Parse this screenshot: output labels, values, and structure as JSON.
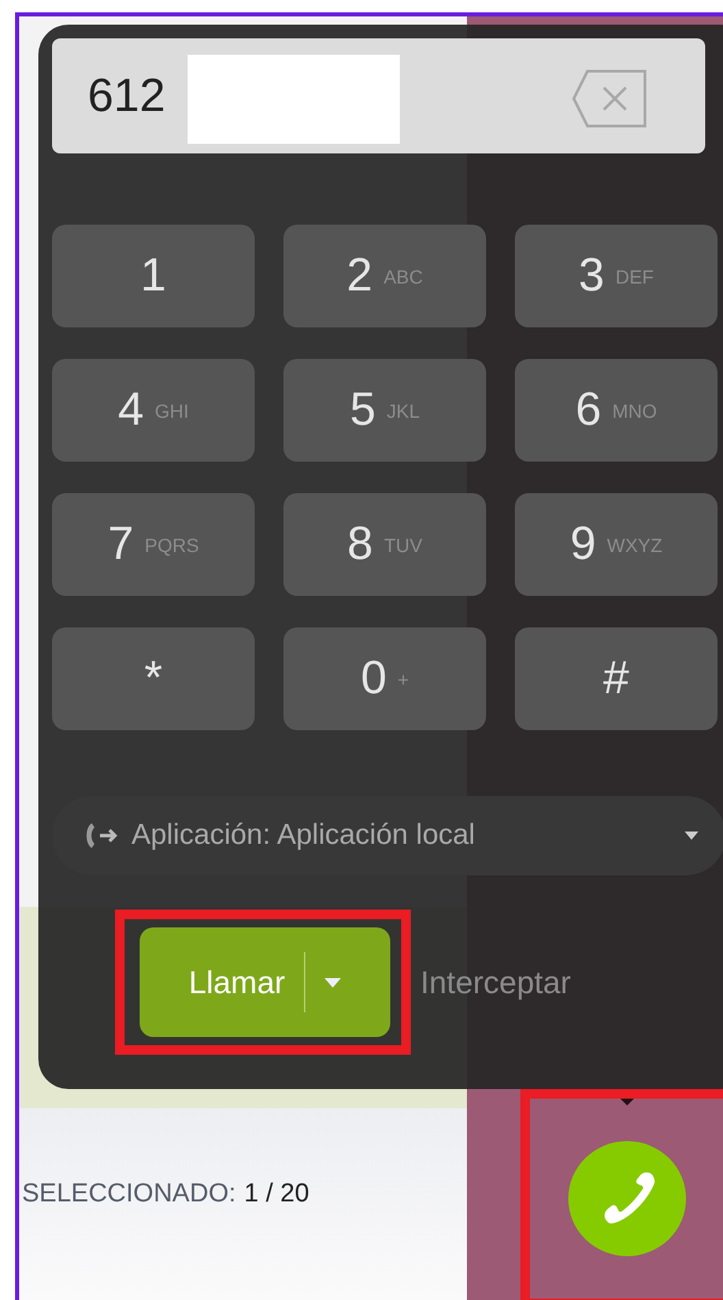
{
  "dialer": {
    "number": "612",
    "keys": [
      {
        "digit": "1"
      },
      {
        "digit": "2",
        "letters": "ABC"
      },
      {
        "digit": "3",
        "letters": "DEF"
      },
      {
        "digit": "4",
        "letters": "GHI"
      },
      {
        "digit": "5",
        "letters": "JKL"
      },
      {
        "digit": "6",
        "letters": "MNO"
      },
      {
        "digit": "7",
        "letters": "PQRS"
      },
      {
        "digit": "8",
        "letters": "TUV"
      },
      {
        "digit": "9",
        "letters": "WXYZ"
      },
      {
        "digit": "*"
      },
      {
        "digit": "0",
        "letters": "+"
      },
      {
        "digit": "#"
      }
    ],
    "line_selector": {
      "label": "Aplicación: Aplicación local"
    },
    "call_button": {
      "label": "Llamar"
    },
    "intercept_link": {
      "label": "Interceptar"
    }
  },
  "footer": {
    "label": "SELECCIONADO:",
    "value": "1 / 20"
  }
}
